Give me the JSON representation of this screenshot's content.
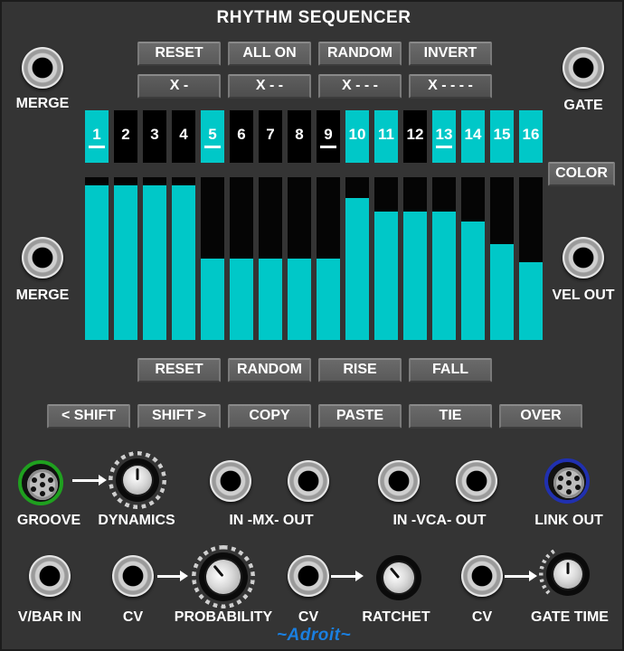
{
  "title": "RHYTHM SEQUENCER",
  "brand": "~Adroit~",
  "labels": {
    "merge_top": "MERGE",
    "merge_mid": "MERGE",
    "gate": "GATE",
    "vel_out": "VEL OUT",
    "groove": "GROOVE",
    "dynamics": "DYNAMICS",
    "mx": "IN -MX- OUT",
    "vca": "IN -VCA- OUT",
    "link_out": "LINK OUT",
    "vbar_in": "V/BAR IN",
    "cv1": "CV",
    "probability": "PROBABILITY",
    "cv2": "CV",
    "ratchet": "RATCHET",
    "cv3": "CV",
    "gate_time": "GATE TIME"
  },
  "top_buttons": [
    "RESET",
    "ALL ON",
    "RANDOM",
    "INVERT"
  ],
  "pattern_buttons": [
    "X -",
    "X - -",
    "X - - -",
    "X - - - -"
  ],
  "color_button": "COLOR",
  "velocity_buttons": [
    "RESET",
    "RANDOM",
    "RISE",
    "FALL"
  ],
  "edit_buttons": [
    "< SHIFT",
    "SHIFT >",
    "COPY",
    "PASTE",
    "TIE",
    "OVER"
  ],
  "steps": [
    {
      "n": "1",
      "on": true,
      "marked": true,
      "velocity": 0.95
    },
    {
      "n": "2",
      "on": false,
      "marked": false,
      "velocity": 0.95
    },
    {
      "n": "3",
      "on": false,
      "marked": false,
      "velocity": 0.95
    },
    {
      "n": "4",
      "on": false,
      "marked": false,
      "velocity": 0.95
    },
    {
      "n": "5",
      "on": true,
      "marked": true,
      "velocity": 0.5
    },
    {
      "n": "6",
      "on": false,
      "marked": false,
      "velocity": 0.5
    },
    {
      "n": "7",
      "on": false,
      "marked": false,
      "velocity": 0.5
    },
    {
      "n": "8",
      "on": false,
      "marked": false,
      "velocity": 0.5
    },
    {
      "n": "9",
      "on": false,
      "marked": true,
      "velocity": 0.5
    },
    {
      "n": "10",
      "on": true,
      "marked": false,
      "velocity": 0.87
    },
    {
      "n": "11",
      "on": true,
      "marked": false,
      "velocity": 0.79
    },
    {
      "n": "12",
      "on": false,
      "marked": false,
      "velocity": 0.79
    },
    {
      "n": "13",
      "on": true,
      "marked": true,
      "velocity": 0.79
    },
    {
      "n": "14",
      "on": true,
      "marked": false,
      "velocity": 0.73
    },
    {
      "n": "15",
      "on": true,
      "marked": false,
      "velocity": 0.59
    },
    {
      "n": "16",
      "on": true,
      "marked": false,
      "velocity": 0.48
    }
  ],
  "colors": {
    "accent": "#00c8c8",
    "panel": "#343434",
    "groove_ring": "#1fa01f",
    "link_ring": "#2030b0",
    "brand": "#1a7fe0"
  }
}
